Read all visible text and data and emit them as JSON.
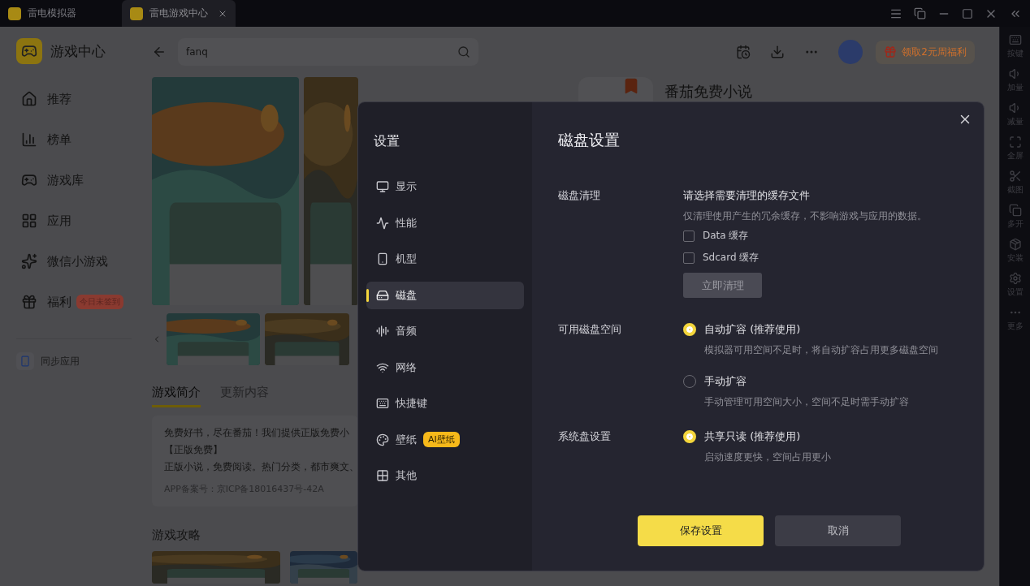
{
  "titlebar": {
    "tabs": [
      {
        "label": "雷电模拟器",
        "selected": false
      },
      {
        "label": "雷电游戏中心",
        "selected": true
      }
    ]
  },
  "sidebar": {
    "title": "游戏中心",
    "items": [
      {
        "label": "推荐",
        "kind": "home"
      },
      {
        "label": "榜单",
        "kind": "chart"
      },
      {
        "label": "游戏库",
        "kind": "gamepad"
      },
      {
        "label": "应用",
        "kind": "apps"
      },
      {
        "label": "微信小游戏",
        "kind": "star"
      },
      {
        "label": "福利",
        "kind": "gift",
        "badge": "今日未签到"
      }
    ],
    "sync": "同步应用"
  },
  "search": {
    "value": "fanq"
  },
  "promo": "领取2元周福利",
  "app_title": "番茄免费小说",
  "detail_tabs": [
    {
      "label": "游戏简介",
      "selected": true
    },
    {
      "label": "更新内容",
      "selected": false
    }
  ],
  "description": [
    "免费好书，尽在番茄！我们提供正版免费小",
    "【正版免费】",
    "正版小说，免费阅读。热门分类，都市爽文、"
  ],
  "icp": "APP备案号：京ICP备18016437号-42A",
  "guides_title": "游戏攻略",
  "toolbar": [
    {
      "label": "按键",
      "kind": "keyboard"
    },
    {
      "label": "加量",
      "kind": "vol-up"
    },
    {
      "label": "减量",
      "kind": "vol-down"
    },
    {
      "label": "全屏",
      "kind": "fullscreen"
    },
    {
      "label": "截图",
      "kind": "scissors"
    },
    {
      "label": "多开",
      "kind": "windows"
    },
    {
      "label": "安装",
      "kind": "apk"
    },
    {
      "label": "设置",
      "kind": "settings"
    },
    {
      "label": "更多",
      "kind": "more"
    }
  ],
  "dialog": {
    "title": "设置",
    "nav": [
      {
        "label": "显示",
        "kind": "monitor",
        "selected": false
      },
      {
        "label": "性能",
        "kind": "activity",
        "selected": false
      },
      {
        "label": "机型",
        "kind": "phone",
        "selected": false
      },
      {
        "label": "磁盘",
        "kind": "disk",
        "selected": true
      },
      {
        "label": "音频",
        "kind": "audio",
        "selected": false
      },
      {
        "label": "网络",
        "kind": "wifi",
        "selected": false
      },
      {
        "label": "快捷键",
        "kind": "keyboard",
        "selected": false
      },
      {
        "label": "壁纸",
        "kind": "palette",
        "selected": false,
        "badge": "AI壁纸"
      },
      {
        "label": "其他",
        "kind": "grid",
        "selected": false
      }
    ],
    "heading": "磁盘设置",
    "clean": {
      "label": "磁盘清理",
      "title": "请选择需要清理的缓存文件",
      "hint": "仅清理使用产生的冗余缓存，不影响游戏与应用的数据。",
      "options": [
        {
          "label": "Data 缓存",
          "checked": false
        },
        {
          "label": "Sdcard 缓存",
          "checked": false
        }
      ],
      "button": "立即清理"
    },
    "space": {
      "label": "可用磁盘空间",
      "options": [
        {
          "label": "自动扩容 (推荐使用)",
          "hint": "模拟器可用空间不足时，将自动扩容占用更多磁盘空间",
          "selected": true
        },
        {
          "label": "手动扩容",
          "hint": "手动管理可用空间大小，空间不足时需手动扩容",
          "selected": false
        }
      ]
    },
    "system": {
      "label": "系统盘设置",
      "options": [
        {
          "label": "共享只读 (推荐使用)",
          "hint": "启动速度更快，空间占用更小",
          "selected": true
        }
      ]
    },
    "save": "保存设置",
    "cancel": "取消"
  }
}
